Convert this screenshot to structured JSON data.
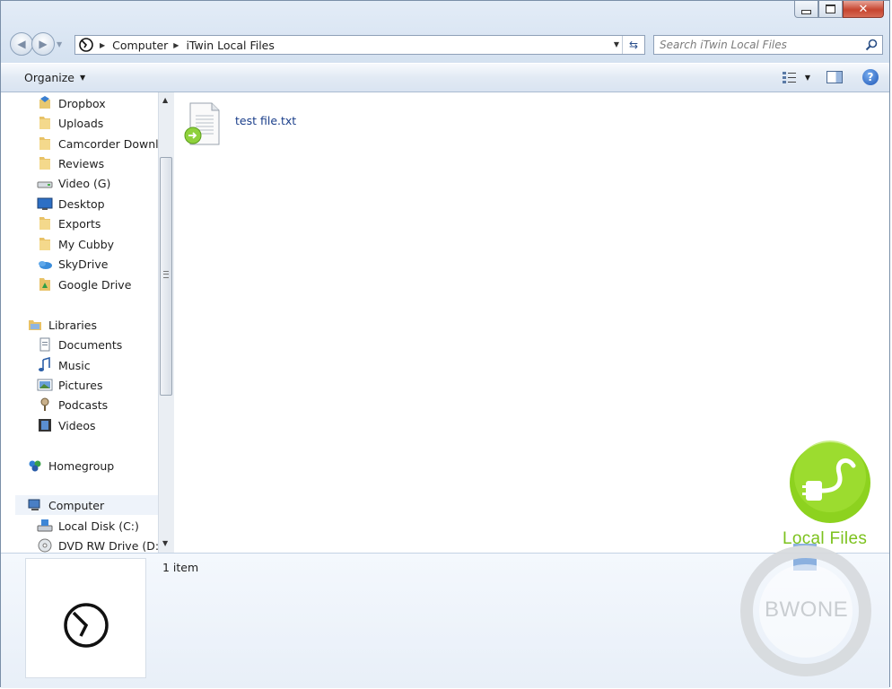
{
  "window": {
    "controls": {
      "minimize": "minimize-icon",
      "maximize": "maximize-icon",
      "close": "close-icon"
    }
  },
  "address_bar": {
    "breadcrumbs": [
      "Computer",
      "iTwin Local Files"
    ]
  },
  "search": {
    "placeholder": "Search iTwin Local Files"
  },
  "toolbar": {
    "organize_label": "Organize"
  },
  "nav_pane": {
    "favorites": [
      {
        "label": "Dropbox",
        "icon": "dropbox-icon"
      },
      {
        "label": "Uploads",
        "icon": "folder-icon"
      },
      {
        "label": "Camcorder Downlo",
        "icon": "folder-icon"
      },
      {
        "label": "Reviews",
        "icon": "folder-icon"
      },
      {
        "label": "Video (G)",
        "icon": "drive-icon"
      },
      {
        "label": "Desktop",
        "icon": "desktop-icon"
      },
      {
        "label": "Exports",
        "icon": "folder-icon"
      },
      {
        "label": "My Cubby",
        "icon": "folder-icon"
      },
      {
        "label": "SkyDrive",
        "icon": "skydrive-icon"
      },
      {
        "label": "Google Drive",
        "icon": "google-drive-icon"
      }
    ],
    "libraries": {
      "label": "Libraries",
      "items": [
        {
          "label": "Documents",
          "icon": "documents-icon"
        },
        {
          "label": "Music",
          "icon": "music-icon"
        },
        {
          "label": "Pictures",
          "icon": "pictures-icon"
        },
        {
          "label": "Podcasts",
          "icon": "podcasts-icon"
        },
        {
          "label": "Videos",
          "icon": "videos-icon"
        }
      ]
    },
    "homegroup": {
      "label": "Homegroup"
    },
    "computer": {
      "label": "Computer",
      "items": [
        {
          "label": "Local Disk (C:)",
          "icon": "local-disk-icon"
        },
        {
          "label": "DVD RW Drive (D:) F",
          "icon": "dvd-drive-icon"
        }
      ]
    }
  },
  "content": {
    "files": [
      {
        "name": "test file.txt",
        "icon": "text-file-synced-icon"
      }
    ]
  },
  "details_pane": {
    "item_count": "1 item"
  },
  "watermark": {
    "label": "Local Files",
    "badge_text": "BWONE"
  },
  "colors": {
    "accent_green": "#7cc21d",
    "link_blue": "#1a3e8a",
    "frame": "#cfdcec"
  }
}
